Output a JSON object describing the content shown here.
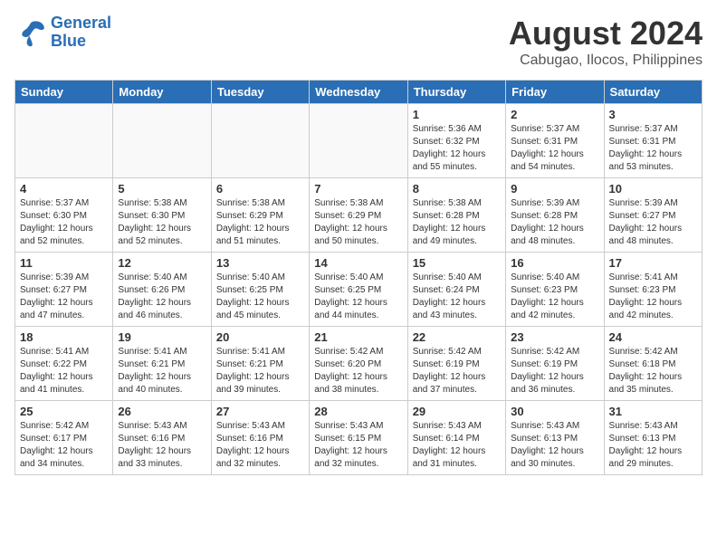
{
  "logo": {
    "line1": "General",
    "line2": "Blue"
  },
  "title": "August 2024",
  "subtitle": "Cabugao, Ilocos, Philippines",
  "days": [
    "Sunday",
    "Monday",
    "Tuesday",
    "Wednesday",
    "Thursday",
    "Friday",
    "Saturday"
  ],
  "weeks": [
    [
      {
        "day": "",
        "info": ""
      },
      {
        "day": "",
        "info": ""
      },
      {
        "day": "",
        "info": ""
      },
      {
        "day": "",
        "info": ""
      },
      {
        "day": "1",
        "info": "Sunrise: 5:36 AM\nSunset: 6:32 PM\nDaylight: 12 hours\nand 55 minutes."
      },
      {
        "day": "2",
        "info": "Sunrise: 5:37 AM\nSunset: 6:31 PM\nDaylight: 12 hours\nand 54 minutes."
      },
      {
        "day": "3",
        "info": "Sunrise: 5:37 AM\nSunset: 6:31 PM\nDaylight: 12 hours\nand 53 minutes."
      }
    ],
    [
      {
        "day": "4",
        "info": "Sunrise: 5:37 AM\nSunset: 6:30 PM\nDaylight: 12 hours\nand 52 minutes."
      },
      {
        "day": "5",
        "info": "Sunrise: 5:38 AM\nSunset: 6:30 PM\nDaylight: 12 hours\nand 52 minutes."
      },
      {
        "day": "6",
        "info": "Sunrise: 5:38 AM\nSunset: 6:29 PM\nDaylight: 12 hours\nand 51 minutes."
      },
      {
        "day": "7",
        "info": "Sunrise: 5:38 AM\nSunset: 6:29 PM\nDaylight: 12 hours\nand 50 minutes."
      },
      {
        "day": "8",
        "info": "Sunrise: 5:38 AM\nSunset: 6:28 PM\nDaylight: 12 hours\nand 49 minutes."
      },
      {
        "day": "9",
        "info": "Sunrise: 5:39 AM\nSunset: 6:28 PM\nDaylight: 12 hours\nand 48 minutes."
      },
      {
        "day": "10",
        "info": "Sunrise: 5:39 AM\nSunset: 6:27 PM\nDaylight: 12 hours\nand 48 minutes."
      }
    ],
    [
      {
        "day": "11",
        "info": "Sunrise: 5:39 AM\nSunset: 6:27 PM\nDaylight: 12 hours\nand 47 minutes."
      },
      {
        "day": "12",
        "info": "Sunrise: 5:40 AM\nSunset: 6:26 PM\nDaylight: 12 hours\nand 46 minutes."
      },
      {
        "day": "13",
        "info": "Sunrise: 5:40 AM\nSunset: 6:25 PM\nDaylight: 12 hours\nand 45 minutes."
      },
      {
        "day": "14",
        "info": "Sunrise: 5:40 AM\nSunset: 6:25 PM\nDaylight: 12 hours\nand 44 minutes."
      },
      {
        "day": "15",
        "info": "Sunrise: 5:40 AM\nSunset: 6:24 PM\nDaylight: 12 hours\nand 43 minutes."
      },
      {
        "day": "16",
        "info": "Sunrise: 5:40 AM\nSunset: 6:23 PM\nDaylight: 12 hours\nand 42 minutes."
      },
      {
        "day": "17",
        "info": "Sunrise: 5:41 AM\nSunset: 6:23 PM\nDaylight: 12 hours\nand 42 minutes."
      }
    ],
    [
      {
        "day": "18",
        "info": "Sunrise: 5:41 AM\nSunset: 6:22 PM\nDaylight: 12 hours\nand 41 minutes."
      },
      {
        "day": "19",
        "info": "Sunrise: 5:41 AM\nSunset: 6:21 PM\nDaylight: 12 hours\nand 40 minutes."
      },
      {
        "day": "20",
        "info": "Sunrise: 5:41 AM\nSunset: 6:21 PM\nDaylight: 12 hours\nand 39 minutes."
      },
      {
        "day": "21",
        "info": "Sunrise: 5:42 AM\nSunset: 6:20 PM\nDaylight: 12 hours\nand 38 minutes."
      },
      {
        "day": "22",
        "info": "Sunrise: 5:42 AM\nSunset: 6:19 PM\nDaylight: 12 hours\nand 37 minutes."
      },
      {
        "day": "23",
        "info": "Sunrise: 5:42 AM\nSunset: 6:19 PM\nDaylight: 12 hours\nand 36 minutes."
      },
      {
        "day": "24",
        "info": "Sunrise: 5:42 AM\nSunset: 6:18 PM\nDaylight: 12 hours\nand 35 minutes."
      }
    ],
    [
      {
        "day": "25",
        "info": "Sunrise: 5:42 AM\nSunset: 6:17 PM\nDaylight: 12 hours\nand 34 minutes."
      },
      {
        "day": "26",
        "info": "Sunrise: 5:43 AM\nSunset: 6:16 PM\nDaylight: 12 hours\nand 33 minutes."
      },
      {
        "day": "27",
        "info": "Sunrise: 5:43 AM\nSunset: 6:16 PM\nDaylight: 12 hours\nand 32 minutes."
      },
      {
        "day": "28",
        "info": "Sunrise: 5:43 AM\nSunset: 6:15 PM\nDaylight: 12 hours\nand 32 minutes."
      },
      {
        "day": "29",
        "info": "Sunrise: 5:43 AM\nSunset: 6:14 PM\nDaylight: 12 hours\nand 31 minutes."
      },
      {
        "day": "30",
        "info": "Sunrise: 5:43 AM\nSunset: 6:13 PM\nDaylight: 12 hours\nand 30 minutes."
      },
      {
        "day": "31",
        "info": "Sunrise: 5:43 AM\nSunset: 6:13 PM\nDaylight: 12 hours\nand 29 minutes."
      }
    ]
  ]
}
